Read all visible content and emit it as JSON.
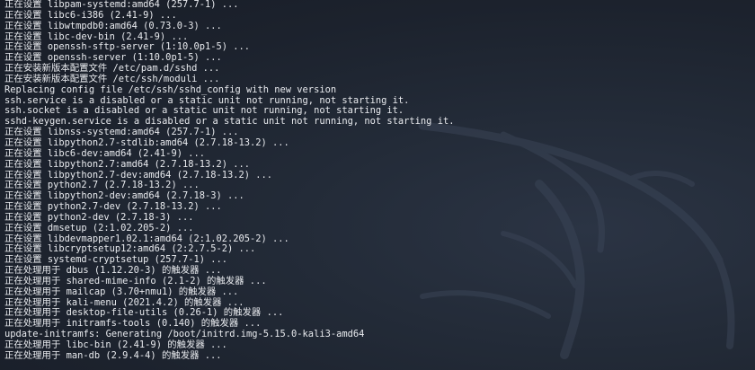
{
  "terminal": {
    "lines": [
      "正在设置 libpam-systemd:amd64 (257.7-1) ...",
      "正在设置 libc6-i386 (2.41-9) ...",
      "正在设置 libwtmpdb0:amd64 (0.73.0-3) ...",
      "正在设置 libc-dev-bin (2.41-9) ...",
      "正在设置 openssh-sftp-server (1:10.0p1-5) ...",
      "正在设置 openssh-server (1:10.0p1-5) ...",
      "正在安装新版本配置文件 /etc/pam.d/sshd ...",
      "正在安装新版本配置文件 /etc/ssh/moduli ...",
      "Replacing config file /etc/ssh/sshd_config with new version",
      "ssh.service is a disabled or a static unit not running, not starting it.",
      "ssh.socket is a disabled or a static unit not running, not starting it.",
      "sshd-keygen.service is a disabled or a static unit not running, not starting it.",
      "正在设置 libnss-systemd:amd64 (257.7-1) ...",
      "正在设置 libpython2.7-stdlib:amd64 (2.7.18-13.2) ...",
      "正在设置 libc6-dev:amd64 (2.41-9) ...",
      "正在设置 libpython2.7:amd64 (2.7.18-13.2) ...",
      "正在设置 libpython2.7-dev:amd64 (2.7.18-13.2) ...",
      "正在设置 python2.7 (2.7.18-13.2) ...",
      "正在设置 libpython2-dev:amd64 (2.7.18-3) ...",
      "正在设置 python2.7-dev (2.7.18-13.2) ...",
      "正在设置 python2-dev (2.7.18-3) ...",
      "正在设置 dmsetup (2:1.02.205-2) ...",
      "正在设置 libdevmapper1.02.1:amd64 (2:1.02.205-2) ...",
      "正在设置 libcryptsetup12:amd64 (2:2.7.5-2) ...",
      "正在设置 systemd-cryptsetup (257.7-1) ...",
      "正在处理用于 dbus (1.12.20-3) 的触发器 ...",
      "正在处理用于 shared-mime-info (2.1-2) 的触发器 ...",
      "正在处理用于 mailcap (3.70+nmu1) 的触发器 ...",
      "正在处理用于 kali-menu (2021.4.2) 的触发器 ...",
      "正在处理用于 desktop-file-utils (0.26-1) 的触发器 ...",
      "正在处理用于 initramfs-tools (0.140) 的触发器 ...",
      "update-initramfs: Generating /boot/initrd.img-5.15.0-kali3-amd64",
      "正在处理用于 libc-bin (2.41-9) 的触发器 ...",
      "正在处理用于 man-db (2.9.4-4) 的触发器 ..."
    ]
  }
}
